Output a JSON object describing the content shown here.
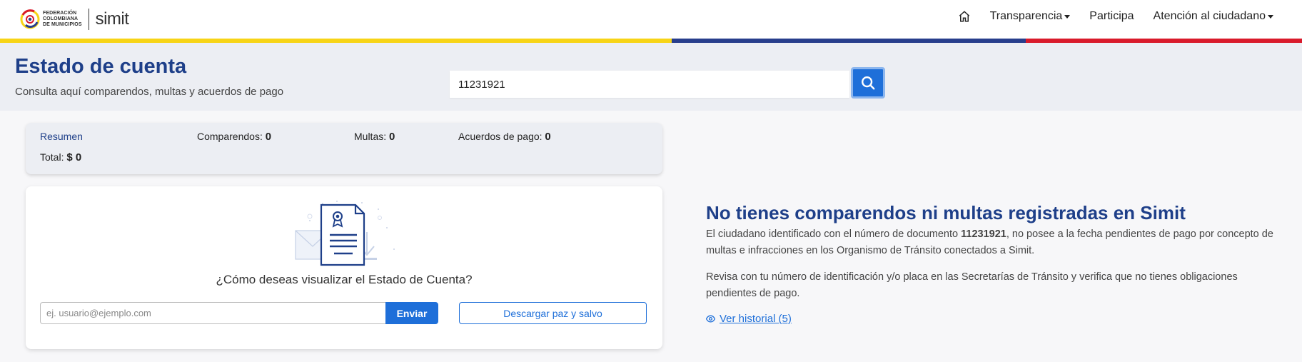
{
  "brand": {
    "fcm_lines": [
      "FEDERACIÓN",
      "COLOMBIANA",
      "DE MUNICIPIOS"
    ],
    "simit_logo_text": "simit"
  },
  "nav": {
    "home_icon": "home-icon",
    "items": [
      {
        "label": "Transparencia",
        "dropdown": true
      },
      {
        "label": "Participa",
        "dropdown": false
      },
      {
        "label": "Atención al ciudadano",
        "dropdown": true
      }
    ]
  },
  "colors": {
    "primary_blue": "#1e3f89",
    "accent_blue": "#1e6fd9",
    "flag_yellow": "#f7d417",
    "flag_blue": "#283e8c",
    "flag_red": "#d91a2b"
  },
  "header": {
    "title": "Estado de cuenta",
    "subtitle": "Consulta aquí comparendos, multas y acuerdos de pago",
    "search_value": "11231921",
    "search_icon": "search-icon"
  },
  "summary": {
    "resumen_label": "Resumen",
    "comparendos_label": "Comparendos:",
    "comparendos_value": "0",
    "multas_label": "Multas:",
    "multas_value": "0",
    "acuerdos_label": "Acuerdos de pago:",
    "acuerdos_value": "0",
    "total_label": "Total:",
    "total_value": "$ 0"
  },
  "download_card": {
    "question": "¿Cómo deseas visualizar el Estado de Cuenta?",
    "email_placeholder": "ej. usuario@ejemplo.com",
    "send_label": "Enviar",
    "paz_salvo_label": "Descargar paz y salvo"
  },
  "info": {
    "title": "No tienes comparendos ni multas registradas en Simit",
    "p1_before": "El ciudadano identificado con el número de documento ",
    "p1_doc": "11231921",
    "p1_after": ", no posee a la fecha pendientes de pago por concepto de multas e infracciones en los Organismo de Tránsito conectados a Simit.",
    "p2": "Revisa con tu número de identificación y/o placa en las Secretarías de Tránsito y verifica que no tienes obligaciones pendientes de pago.",
    "historial_label": "Ver historial (5)",
    "historial_icon": "eye-icon"
  }
}
